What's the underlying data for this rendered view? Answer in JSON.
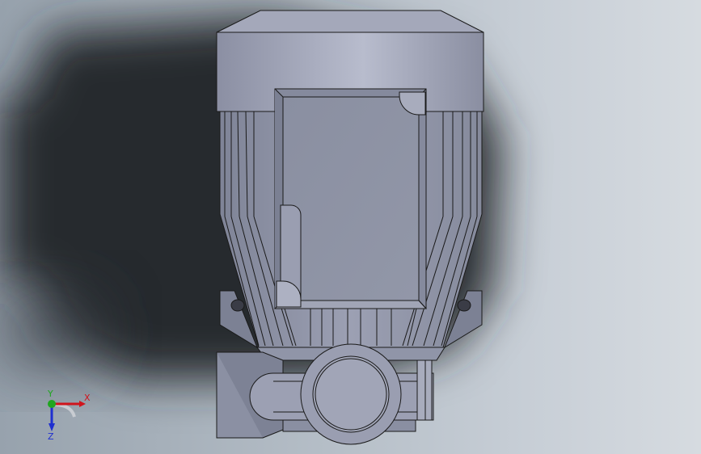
{
  "viewport": {
    "background_colors": [
      "#97a2ad",
      "#c7ced6",
      "#d6dbe0"
    ],
    "shadow_color": "#2a2e33"
  },
  "model": {
    "body_color": "#8e93a6",
    "highlight_color": "#b9bdd0",
    "edge_color": "#1a1a1a",
    "shaft_color": "#9a9eb0"
  },
  "triad": {
    "x_label": "X",
    "y_label": "Y",
    "z_label": "Z",
    "x_color": "#d0141c",
    "y_color": "#1fa61f",
    "z_color": "#1e2fd0"
  }
}
